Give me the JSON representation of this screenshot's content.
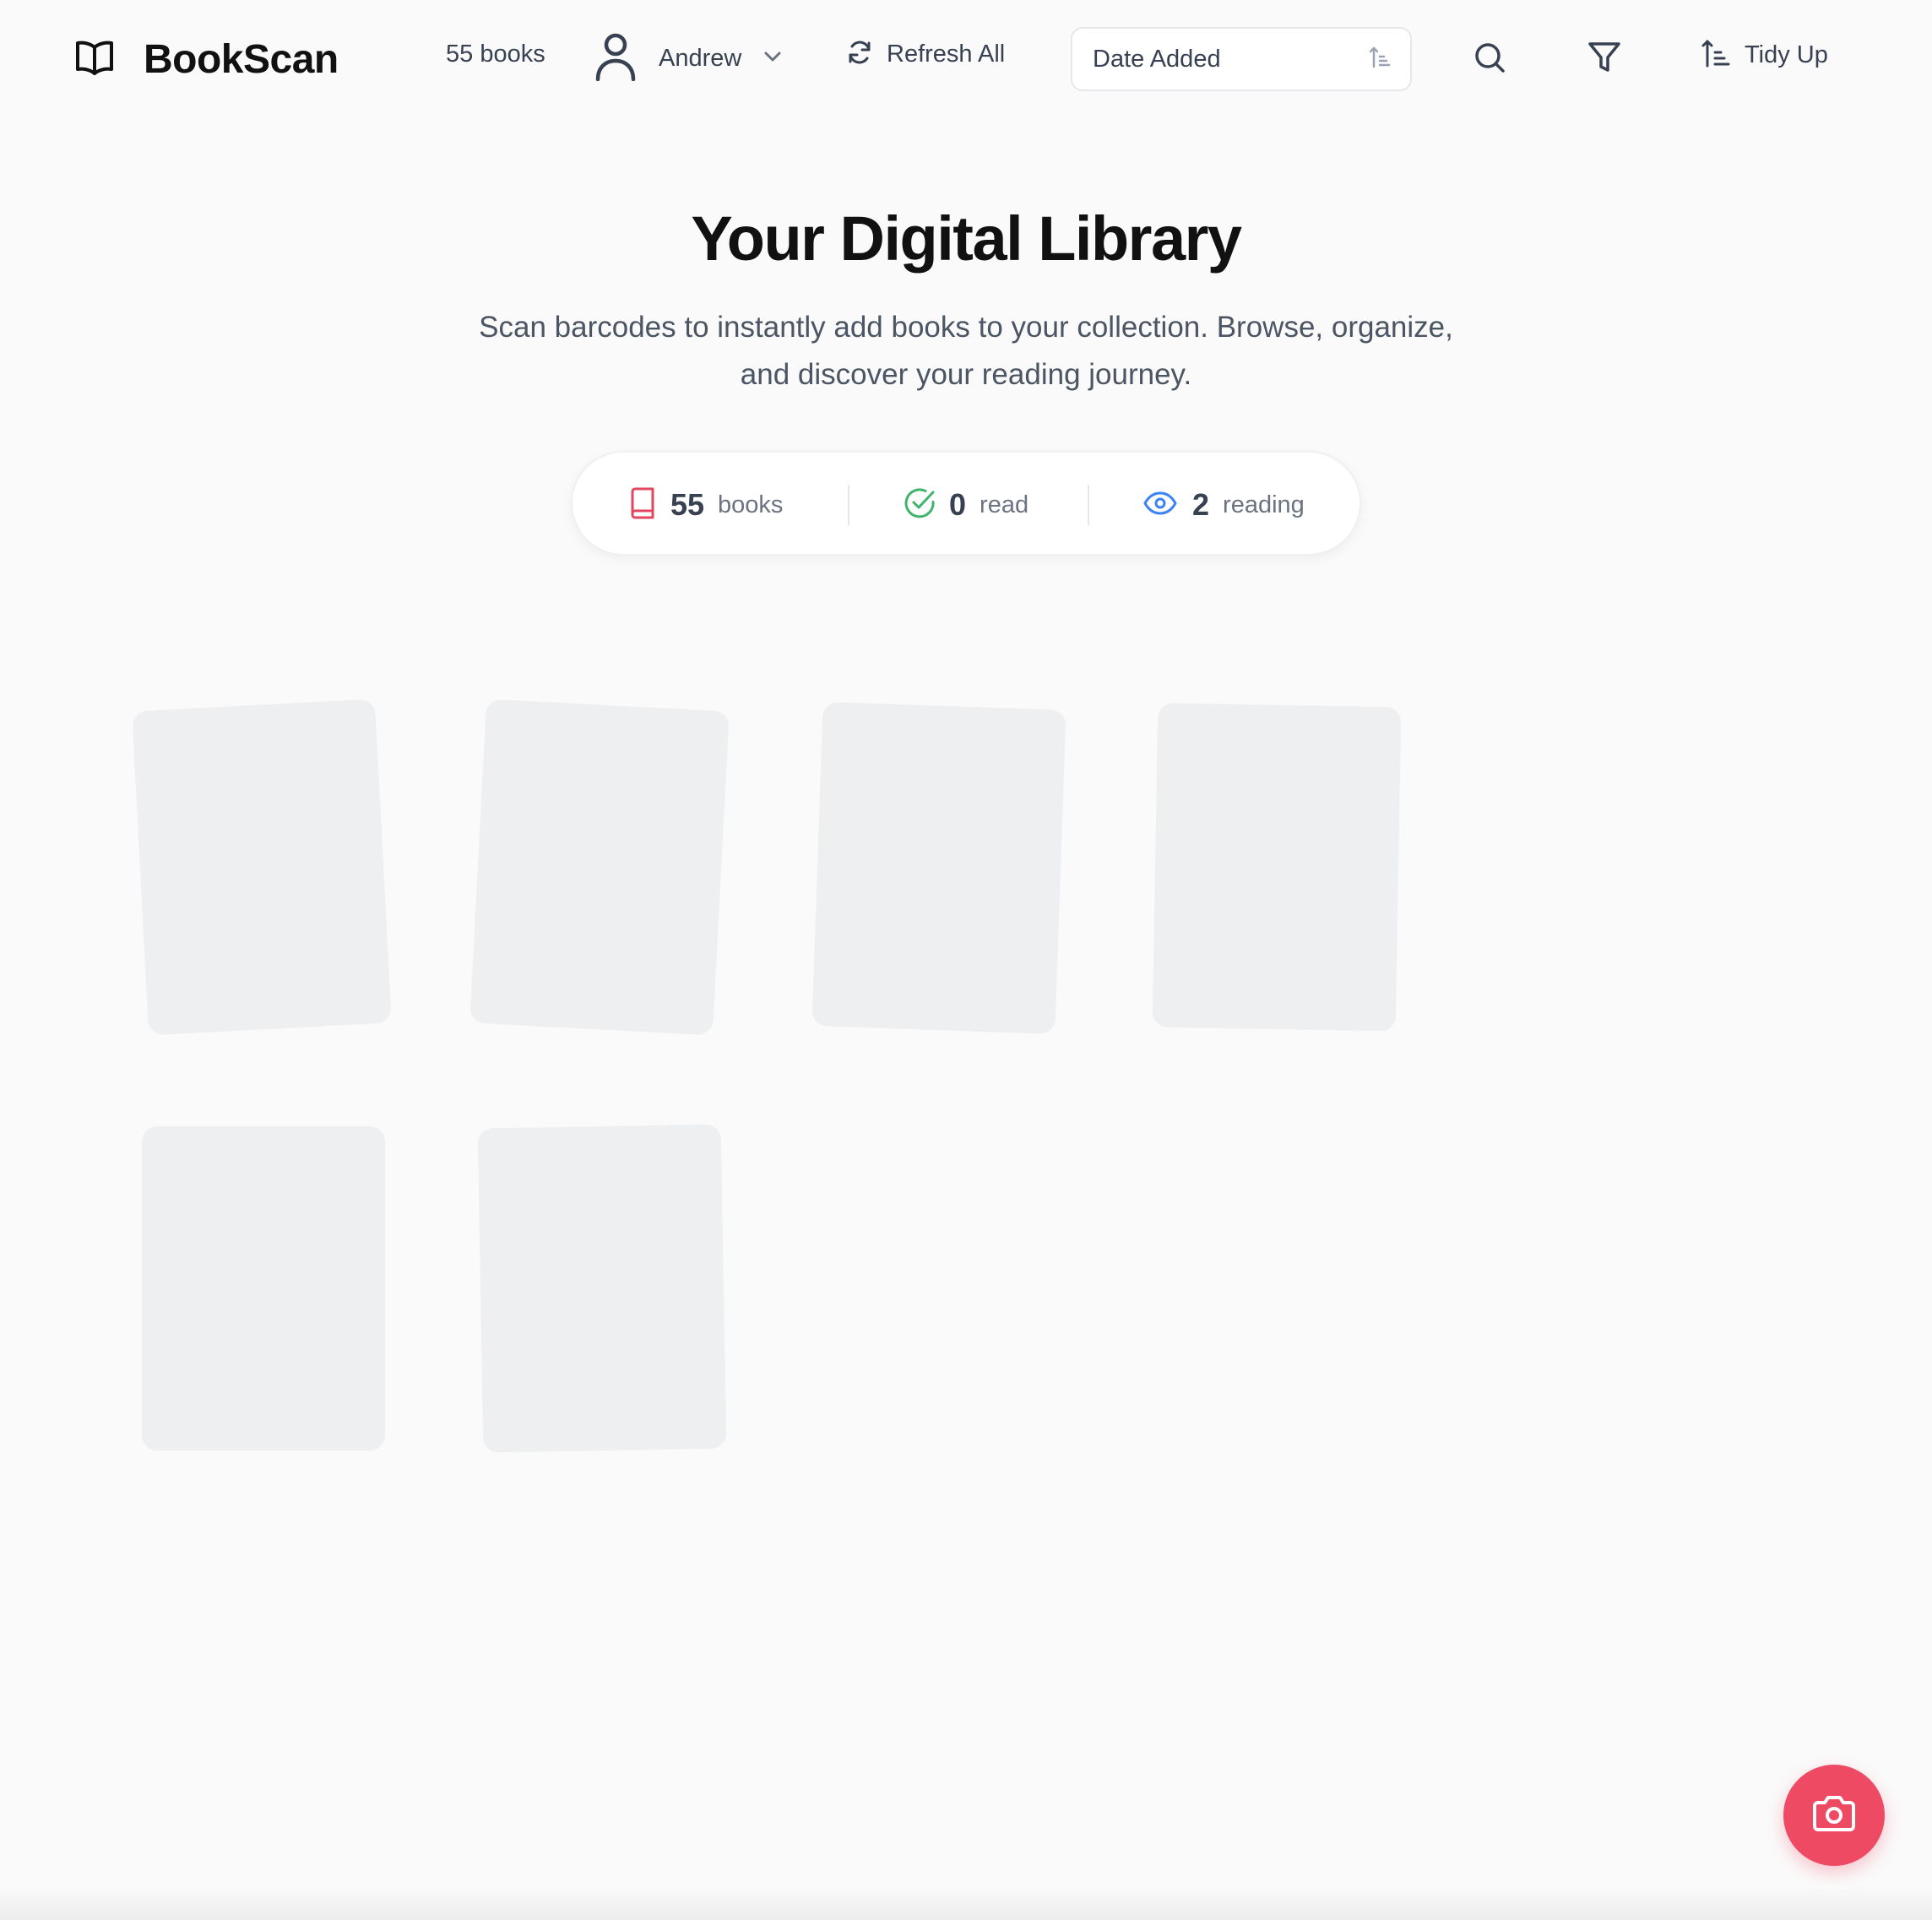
{
  "header": {
    "brand": "BookScan",
    "book_count": "55 books",
    "user_name": "Andrew",
    "refresh_label": "Refresh All",
    "sort_value": "Date Added",
    "tidy_label": "Tidy Up",
    "icons": {
      "logo": "open-book-icon",
      "user": "user-icon",
      "chevron": "chevron-down-icon",
      "refresh": "refresh-icon",
      "sort_direction": "sort-ascending-icon",
      "search": "search-icon",
      "filter": "filter-icon",
      "tidy": "sort-ascending-icon"
    }
  },
  "hero": {
    "title": "Your Digital Library",
    "subtitle_line1": "Scan barcodes to instantly add books to your collection. Browse, organize,",
    "subtitle_line2": "and discover your reading journey."
  },
  "stats": [
    {
      "value": "55",
      "label": "books",
      "icon": "book-icon",
      "color": "#e0475e"
    },
    {
      "value": "0",
      "label": "read",
      "icon": "check-circle-icon",
      "color": "#3fb36b"
    },
    {
      "value": "2",
      "label": "reading",
      "icon": "eye-icon",
      "color": "#3b82f6"
    }
  ],
  "book_placeholders": 6,
  "fab": {
    "icon": "camera-icon",
    "color": "#ef4a63"
  },
  "colors": {
    "background": "#fafafa",
    "placeholder": "#eeeff1",
    "accent": "#ef4a63"
  }
}
